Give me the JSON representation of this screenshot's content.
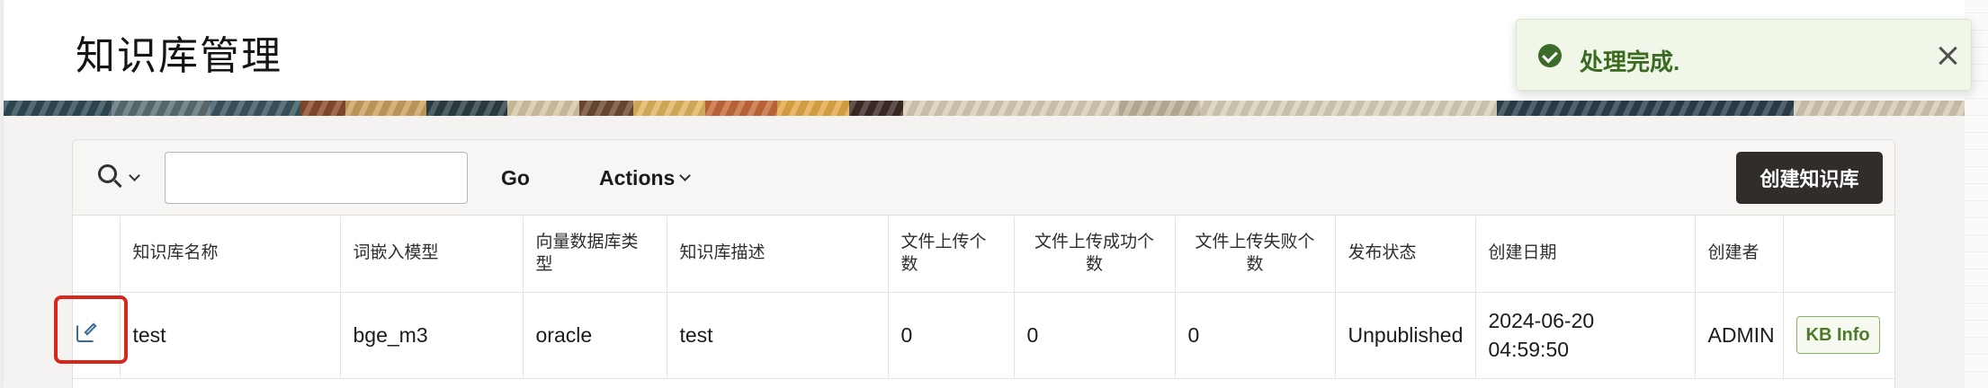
{
  "header": {
    "title": "知识库管理"
  },
  "toast": {
    "message": "处理完成."
  },
  "toolbar": {
    "search_placeholder": "",
    "go_label": "Go",
    "actions_label": "Actions",
    "create_label": "创建知识库"
  },
  "table": {
    "columns": [
      "",
      "知识库名称",
      "词嵌入模型",
      "向量数据库类型",
      "知识库描述",
      "文件上传个数",
      "文件上传成功个数",
      "文件上传失败个数",
      "发布状态",
      "创建日期",
      "创建者",
      ""
    ],
    "rows": [
      {
        "name": "test",
        "embedding_model": "bge_m3",
        "vector_db": "oracle",
        "description": "test",
        "upload_count": "0",
        "upload_success": "0",
        "upload_failed": "0",
        "status": "Unpublished",
        "created_date": "2024-06-20",
        "created_time": "04:59:50",
        "creator": "ADMIN",
        "info_label": "KB Info"
      }
    ]
  },
  "colors": {
    "toast_text": "#3a6b21",
    "highlight": "#d9261c",
    "primary_button": "#312d2a"
  }
}
